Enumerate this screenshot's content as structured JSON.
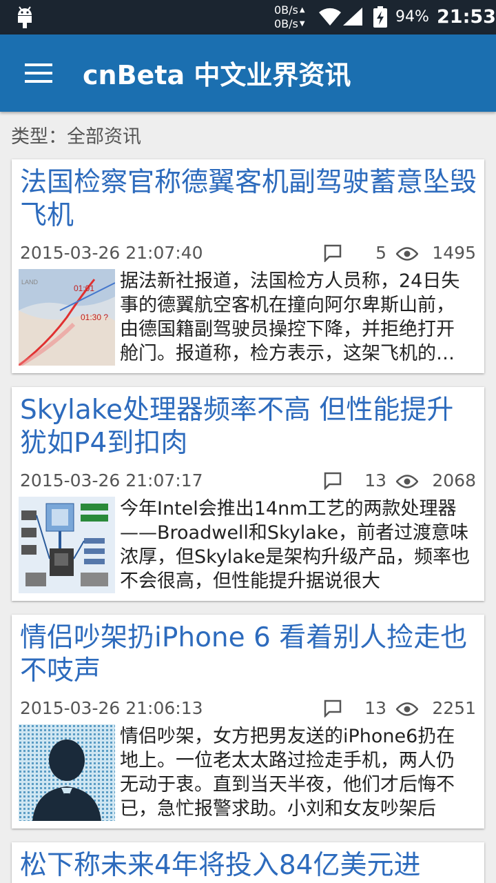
{
  "status_bar": {
    "speed_up": "0B/s",
    "speed_down": "0B/s",
    "battery": "94%",
    "time": "21:53",
    "icons": [
      "android-icon",
      "wifi-icon",
      "signal-icon",
      "battery-charging-icon"
    ]
  },
  "app_bar": {
    "title": "cnBeta 中文业界资讯",
    "menu_icon": "hamburger-menu-icon",
    "color": "#1b6fb0"
  },
  "filter": {
    "label": "类型：全部资讯"
  },
  "articles": [
    {
      "title": "法国检察官称德翼客机副驾驶蓄意坠毁飞机",
      "date": "2015-03-26 21:07:40",
      "comments": "5",
      "views": "1495",
      "summary": "据法新社报道，法国检方人员称，24日失事的德翼航空客机在撞向阿尔卑斯山前，由德国籍副驾驶员操控下降，并拒绝打开舱门。报道称，检方表示，这架飞机的副驾驶员"
    },
    {
      "title": "Skylake处理器频率不高 但性能提升犹如P4到扣肉",
      "date": "2015-03-26 21:07:17",
      "comments": "13",
      "views": "2068",
      "summary": "今年Intel会推出14nm工艺的两款处理器——Broadwell和Skylake，前者过渡意味浓厚，但Skylake是架构升级产品，频率也不会很高，但性能提升据说很大"
    },
    {
      "title": "情侣吵架扔iPhone 6 看着别人捡走也不吱声",
      "date": "2015-03-26 21:06:13",
      "comments": "13",
      "views": "2251",
      "summary": "情侣吵架，女方把男友送的iPhone6扔在地上。一位老太太路过捡走手机，两人仍无动于衷。直到当天半夜，他们才后悔不已，急忙报警求助。小刘和女友吵架后"
    },
    {
      "title": "松下称未来4年将投入84亿美元进"
    }
  ],
  "colors": {
    "title_blue": "#2d6bbd",
    "status_bar": "#1b2530",
    "background": "#eeeeee"
  }
}
